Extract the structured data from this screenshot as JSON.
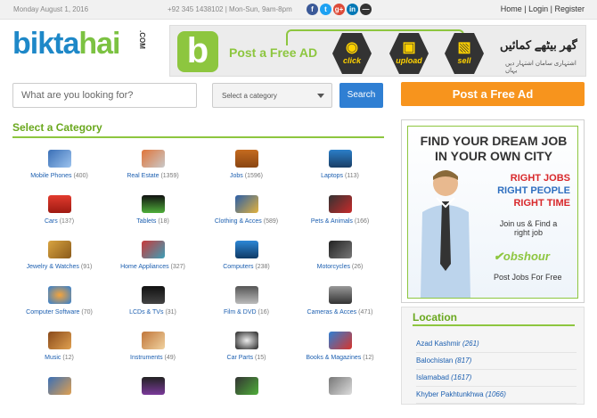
{
  "topbar": {
    "date": "Monday August 1, 2016",
    "phone": "+92 345 1438102 | Mon-Sun, 9am-8pm",
    "social": [
      "f",
      "t",
      "g+",
      "in",
      "—"
    ],
    "links": {
      "home": "Home",
      "sep1": " | ",
      "login": "Login",
      "sep2": " | ",
      "register": "Register"
    }
  },
  "logo": {
    "part1": "bikta",
    "part2": "hai",
    "suffix": ".COM"
  },
  "banner": {
    "post_free": "Post a Free AD",
    "buttons": [
      "click",
      "upload",
      "sell"
    ],
    "urdu_title": "گھر بیٹھے کمائیں",
    "urdu_sub": "اشتہاری سامان اشتہار دیں یہاں"
  },
  "search": {
    "placeholder": "What are you looking for?",
    "category_placeholder": "Select a category",
    "button": "Search"
  },
  "post_ad_button": "Post a Free Ad",
  "categories_heading": "Select a Category",
  "categories": [
    {
      "label": "Mobile Phones",
      "count": "(400)"
    },
    {
      "label": "Real Estate",
      "count": "(1359)"
    },
    {
      "label": "Jobs",
      "count": "(1596)"
    },
    {
      "label": "Laptops",
      "count": "(113)"
    },
    {
      "label": "Cars",
      "count": "(137)"
    },
    {
      "label": "Tablets",
      "count": "(18)"
    },
    {
      "label": "Clothing & Acces",
      "count": "(589)"
    },
    {
      "label": "Pets & Animals",
      "count": "(166)"
    },
    {
      "label": "Jewelry & Watches",
      "count": "(91)"
    },
    {
      "label": "Home Appliances",
      "count": "(327)"
    },
    {
      "label": "Computers",
      "count": "(238)"
    },
    {
      "label": "Motorcycles",
      "count": "(26)"
    },
    {
      "label": "Computer Software",
      "count": "(70)"
    },
    {
      "label": "LCDs & TVs",
      "count": "(31)"
    },
    {
      "label": "Film & DVD",
      "count": "(16)"
    },
    {
      "label": "Cameras & Acces",
      "count": "(471)"
    },
    {
      "label": "Music",
      "count": "(12)"
    },
    {
      "label": "Instruments",
      "count": "(49)"
    },
    {
      "label": "Car Parts",
      "count": "(15)"
    },
    {
      "label": "Books & Magazines",
      "count": "(12)"
    }
  ],
  "ad": {
    "headline1": "FIND YOUR DREAM JOB",
    "headline2": "IN YOUR OWN CITY",
    "right_jobs": "RIGHT JOBS",
    "right_people": "RIGHT PEOPLE",
    "right_time": "RIGHT TIME",
    "join_line1": "Join us  & Find a",
    "join_line2": "right job",
    "brand": "obshour",
    "post_jobs": "Post Jobs For Free"
  },
  "location": {
    "heading": "Location",
    "items": [
      {
        "name": "Azad Kashmir",
        "count": "(261)"
      },
      {
        "name": "Balochistan",
        "count": "(817)"
      },
      {
        "name": "Islamabad",
        "count": "(1617)"
      },
      {
        "name": "Khyber Pakhtunkhwa",
        "count": "(1066)"
      }
    ]
  },
  "colors": {
    "green": "#8dc63f",
    "blue": "#2f7fd3",
    "orange": "#f7941d",
    "link": "#1c5fb0"
  }
}
